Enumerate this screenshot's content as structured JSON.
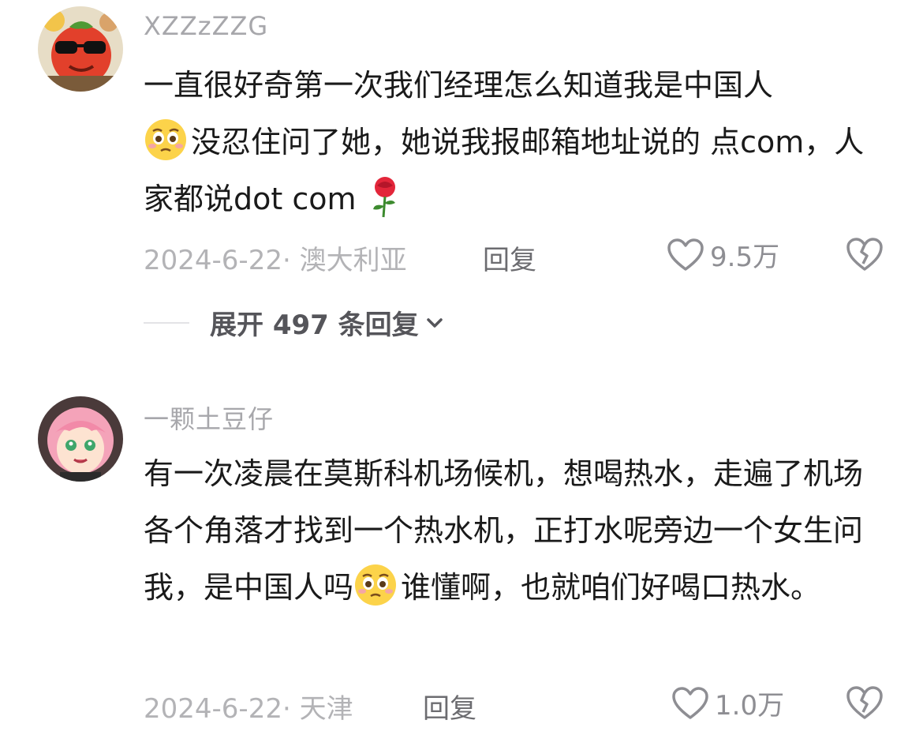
{
  "comments": [
    {
      "username": "XZZzZZG",
      "avatar_icon": "tomato-sunglasses-avatar",
      "text_part1": "一直很好奇第一次我们经理怎么知道我是中国人",
      "emoji1": "pleading-face-emoji",
      "text_part2": "没忍住问了她，她说我报邮箱地址说的 点com，人家都说dot com",
      "emoji2": "rose-emoji",
      "date": "2024-6-22",
      "location": "澳大利亚",
      "reply_label": "回复",
      "likes": "9.5万",
      "expand_label": "展开 497 条回复"
    },
    {
      "username": "一颗土豆仔",
      "avatar_icon": "pink-hair-anime-girl-avatar",
      "text_part1": "有一次凌晨在莫斯科机场候机，想喝热水，走遍了机场各个角落才找到一个热水机，正打水呢旁边一个女生问我，是中国人吗",
      "emoji1": "pleading-face-emoji",
      "text_part2": "谁懂啊，也就咱们好喝口热水。",
      "date": "2024-6-22",
      "location": "天津",
      "reply_label": "回复",
      "likes": "1.0万"
    }
  ],
  "colors": {
    "meta": "#b3b3b6",
    "username": "#a7a7ab",
    "body": "#1a1a1a",
    "icon": "#8e8e93"
  }
}
